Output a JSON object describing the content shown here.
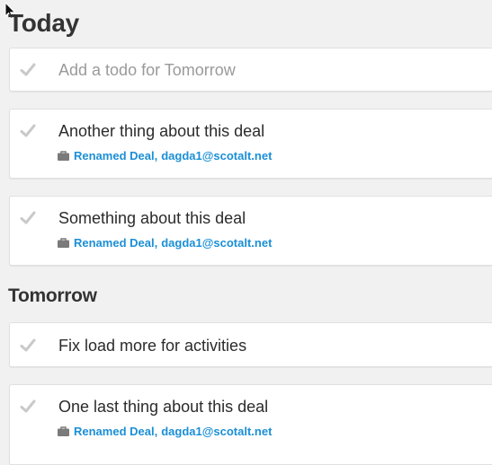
{
  "sections": {
    "today": {
      "title": "Today",
      "add_placeholder": "Add a todo for Tomorrow",
      "items": [
        {
          "text": "Another thing about this deal",
          "deal": "Renamed Deal",
          "contact": "dagda1@scotalt.net"
        },
        {
          "text": "Something about this deal",
          "deal": "Renamed Deal",
          "contact": "dagda1@scotalt.net"
        }
      ]
    },
    "tomorrow": {
      "title": "Tomorrow",
      "items": [
        {
          "text": "Fix load more for activities"
        },
        {
          "text": "One last thing about this deal",
          "deal": "Renamed Deal",
          "contact": "dagda1@scotalt.net"
        }
      ]
    }
  },
  "meta_separator": ",",
  "icons": {
    "check": "checkmark-icon",
    "deal": "briefcase-icon",
    "cursor": "mouse-pointer-icon"
  },
  "colors": {
    "background": "#f1f1f1",
    "link": "#1b8fd6",
    "check": "#c9c9c9",
    "text": "#2b2b2b",
    "placeholder": "#9a9a9a"
  }
}
